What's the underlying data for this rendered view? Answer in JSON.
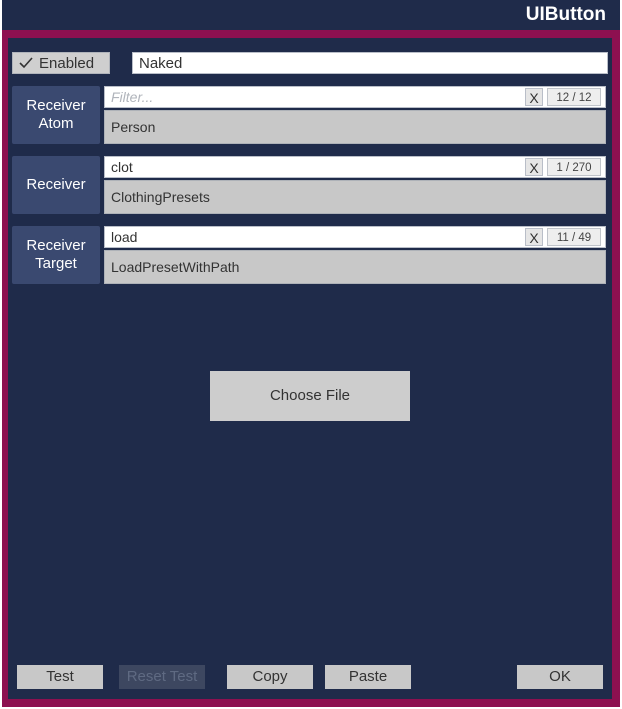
{
  "window": {
    "title": "UIButton"
  },
  "enabled": {
    "checked": true,
    "label": "Enabled"
  },
  "name_field": {
    "value": "Naked"
  },
  "rows": [
    {
      "label": "Receiver\nAtom",
      "filter_value": "",
      "filter_placeholder": "Filter...",
      "clear": "X",
      "count": "12 / 12",
      "selected": "Person"
    },
    {
      "label": "Receiver",
      "filter_value": "clot",
      "filter_placeholder": "",
      "clear": "X",
      "count": "1 / 270",
      "selected": "ClothingPresets"
    },
    {
      "label": "Receiver\nTarget",
      "filter_value": "load",
      "filter_placeholder": "",
      "clear": "X",
      "count": "11 / 49",
      "selected": "LoadPresetWithPath"
    }
  ],
  "choose_file": "Choose File",
  "footer": {
    "test": "Test",
    "reset_test": "Reset Test",
    "copy": "Copy",
    "paste": "Paste",
    "ok": "OK"
  },
  "colors": {
    "frame": "#8d1050",
    "panel": "#1f2b4a",
    "label_cell": "#3a4970",
    "button": "#c8c8c8"
  }
}
